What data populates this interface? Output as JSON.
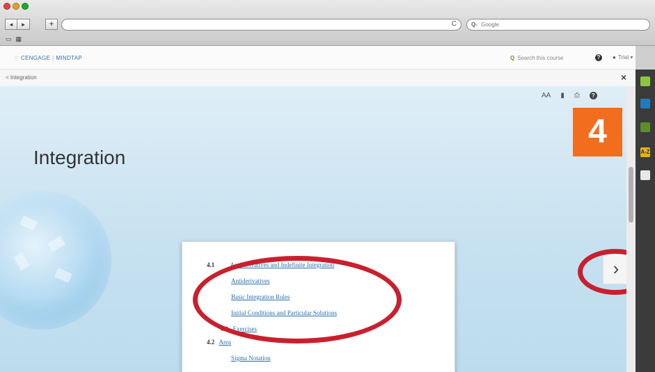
{
  "browser": {
    "back_icon": "◂",
    "forward_icon": "▸",
    "add_label": "+",
    "reload_icon": "C",
    "search_prefix": "Q-",
    "search_placeholder": "Google",
    "bookmarks": [
      "▭",
      "▦"
    ]
  },
  "header": {
    "brand_left": "CENGAGE",
    "brand_right": "MINDTAP",
    "search_label": "Search this course",
    "help_label": "?",
    "user_label": "Trial"
  },
  "breadcrumb": {
    "text": "< Integration",
    "close_label": "×"
  },
  "toolbar": {
    "text_size_label": "AA",
    "bookmark_label": "▮",
    "print_label": "⎙",
    "help_label": "?"
  },
  "chapter": {
    "number": "4",
    "title": "Integration",
    "accent_color": "#f36d1f"
  },
  "toc": [
    {
      "num": "4.1",
      "text": "Antiderivatives and Indefinite Integration"
    },
    {
      "num": "",
      "text": "Antiderivatives"
    },
    {
      "num": "",
      "text": "Basic Integration Rules"
    },
    {
      "num": "",
      "text": "Initial Conditions and Particular Solutions"
    },
    {
      "num": "4.1",
      "text": "Exercises"
    },
    {
      "num": "4.2",
      "text": "Area"
    },
    {
      "num": "",
      "text": "Sigma Notation"
    }
  ],
  "next_label": "›",
  "annotation_color": "#c8202e",
  "tools": [
    "pencil-icon",
    "book-icon",
    "share-icon",
    "glossary-icon",
    "notes-icon"
  ],
  "tool_labels": {
    "glossary": "A-Z"
  }
}
